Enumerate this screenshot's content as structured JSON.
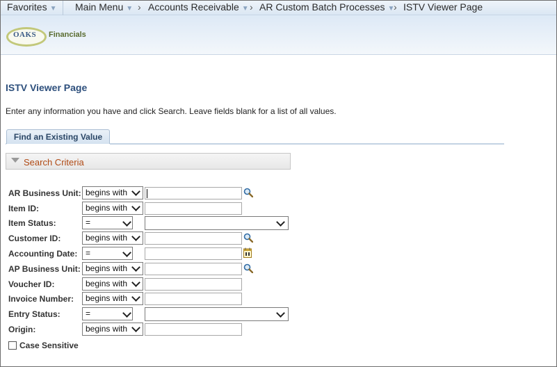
{
  "nav": {
    "favorites": "Favorites",
    "main_menu": "Main Menu",
    "crumbs": [
      "Accounts Receivable",
      "AR Custom Batch Processes",
      "ISTV Viewer Page"
    ],
    "crumb_separator": "›"
  },
  "logo": {
    "primary": "OAKS",
    "secondary": "Financials"
  },
  "page": {
    "title": "ISTV Viewer Page",
    "instructions": "Enter any information you have and click Search. Leave fields blank for a list of all values.",
    "tab_label": "Find an Existing Value",
    "criteria_label": "Search Criteria"
  },
  "fields": [
    {
      "label": "AR Business Unit:",
      "operator": "begins with",
      "value": "",
      "lookup": "search-icon"
    },
    {
      "label": "Item ID:",
      "operator": "begins with",
      "value": ""
    },
    {
      "label": "Item Status:",
      "operator": "=",
      "value": ""
    },
    {
      "label": "Customer ID:",
      "operator": "begins with",
      "value": "",
      "lookup": "search-icon"
    },
    {
      "label": "Accounting Date:",
      "operator": "=",
      "value": "",
      "lookup": "calendar-icon"
    },
    {
      "label": "AP Business Unit:",
      "operator": "begins with",
      "value": "",
      "lookup": "search-icon"
    },
    {
      "label": "Voucher ID:",
      "operator": "begins with",
      "value": ""
    },
    {
      "label": "Invoice Number:",
      "operator": "begins with",
      "value": ""
    },
    {
      "label": "Entry Status:",
      "operator": "=",
      "value": ""
    },
    {
      "label": "Origin:",
      "operator": "begins with",
      "value": ""
    }
  ],
  "case_sensitive": {
    "label": "Case Sensitive",
    "checked": false
  },
  "colors": {
    "title": "#2d4f7c",
    "criteria_label": "#b04a14",
    "nav_bg": "#dbe7f3"
  }
}
